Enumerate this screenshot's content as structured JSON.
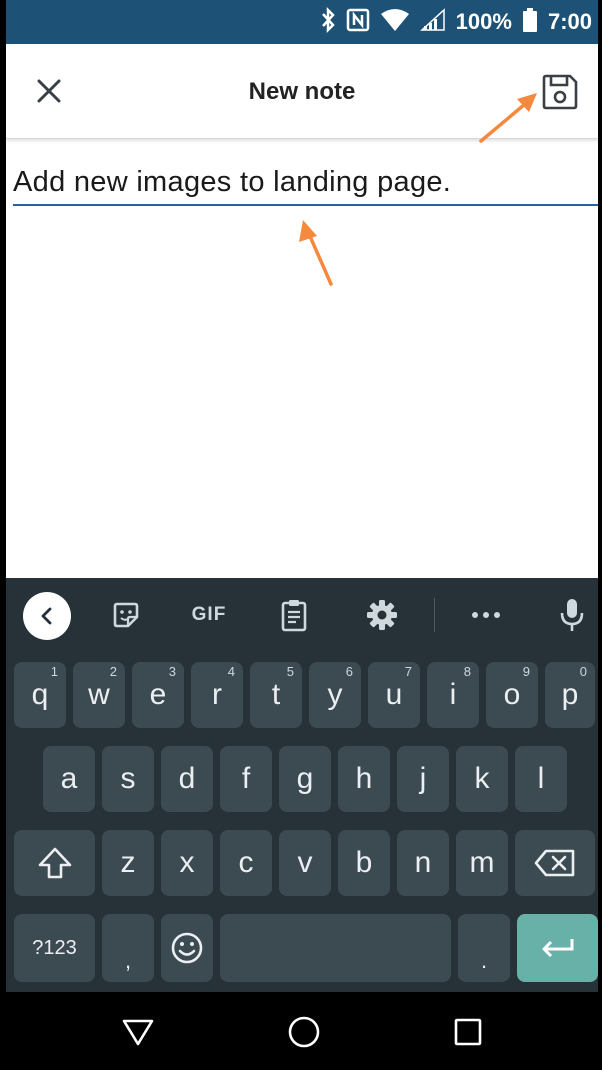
{
  "status_bar": {
    "icons": [
      "bluetooth-icon",
      "nfc-icon",
      "wifi-icon",
      "signal-icon"
    ],
    "battery_percent": "100%",
    "time": "7:00"
  },
  "app_bar": {
    "close_icon": "close-icon",
    "title": "New note",
    "save_icon": "save-icon"
  },
  "note": {
    "value": "Add new images to landing page."
  },
  "annotations": {
    "arrow_color": "#f5893d"
  },
  "keyboard": {
    "suggestion_bar": {
      "back_icon": "chevron-left-icon",
      "sticker_icon": "sticker-icon",
      "gif_label": "GIF",
      "clipboard_icon": "clipboard-icon",
      "settings_icon": "gear-icon",
      "more_icon": "more-icon",
      "mic_icon": "mic-icon"
    },
    "row1": [
      {
        "key": "q",
        "hint": "1"
      },
      {
        "key": "w",
        "hint": "2"
      },
      {
        "key": "e",
        "hint": "3"
      },
      {
        "key": "r",
        "hint": "4"
      },
      {
        "key": "t",
        "hint": "5"
      },
      {
        "key": "y",
        "hint": "6"
      },
      {
        "key": "u",
        "hint": "7"
      },
      {
        "key": "i",
        "hint": "8"
      },
      {
        "key": "o",
        "hint": "9"
      },
      {
        "key": "p",
        "hint": "0"
      }
    ],
    "row2": [
      "a",
      "s",
      "d",
      "f",
      "g",
      "h",
      "j",
      "k",
      "l"
    ],
    "row3": [
      "z",
      "x",
      "c",
      "v",
      "b",
      "n",
      "m"
    ],
    "row4": {
      "symbols_label": "?123",
      "comma_label": ",",
      "period_label": "."
    },
    "colors": {
      "background": "#263238",
      "key": "#3c4a52",
      "enter": "#67b1a9"
    }
  },
  "nav_bar": {
    "back_icon": "triangle-back-icon",
    "home_icon": "circle-home-icon",
    "recents_icon": "square-recents-icon"
  }
}
